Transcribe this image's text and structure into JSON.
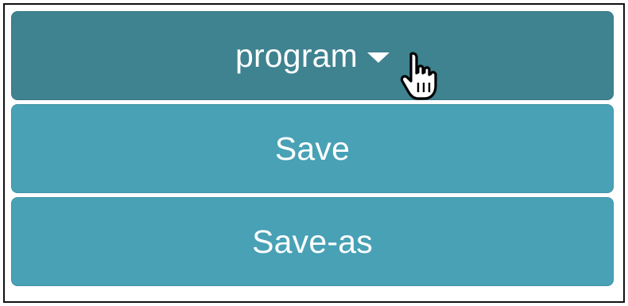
{
  "menu": {
    "toggle_label": "program",
    "items": [
      {
        "label": "Save"
      },
      {
        "label": "Save-as"
      }
    ]
  },
  "icons": {
    "caret": "caret-down-icon",
    "cursor": "hand-pointer-cursor-icon"
  },
  "colors": {
    "toggle_bg": "#3f8290",
    "item_bg": "#48a1b5",
    "text": "#ffffff"
  }
}
